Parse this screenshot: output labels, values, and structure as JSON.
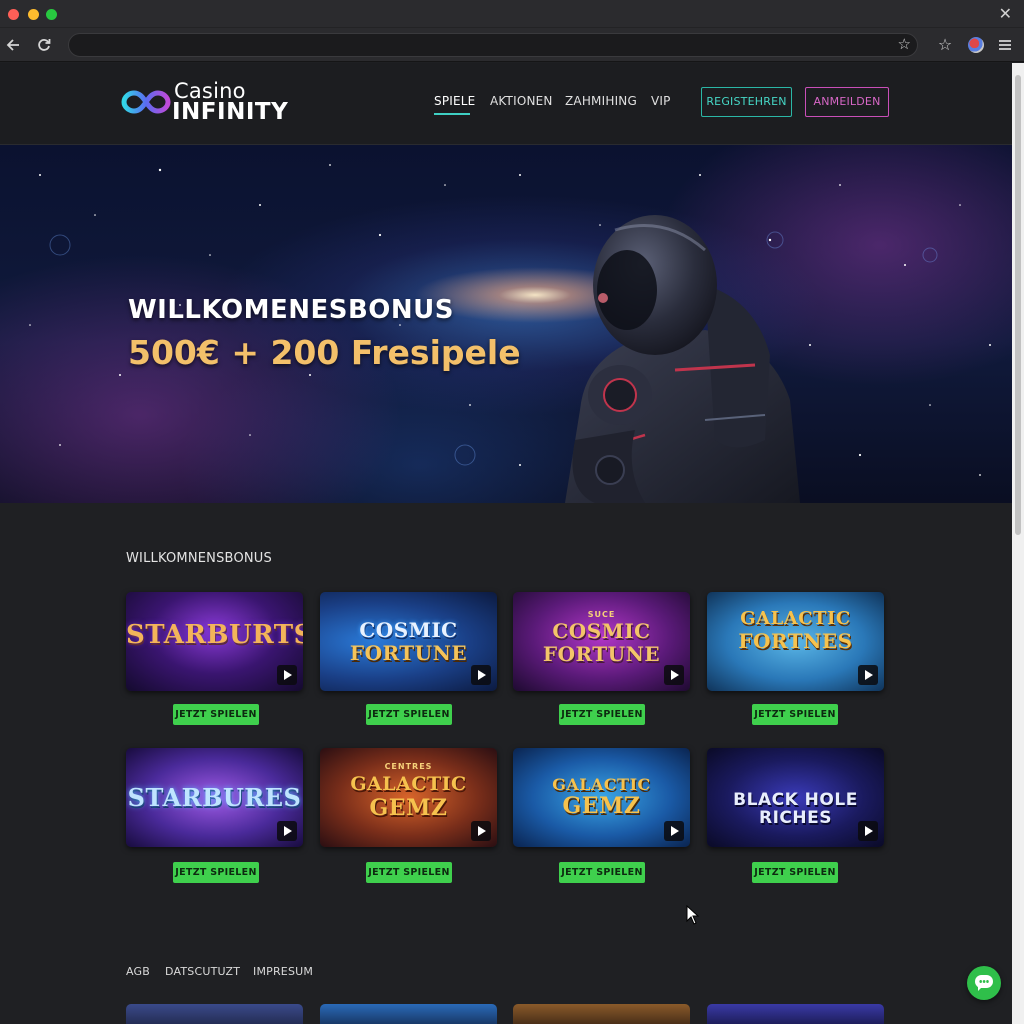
{
  "browser": {
    "close_glyph": "✕",
    "back_icon": "arrow-left-icon",
    "reload_icon": "reload-icon",
    "bookmark_icon": "star-icon",
    "menu_icon": "hamburger-menu-icon",
    "address_value": ""
  },
  "header": {
    "logo_top": "Casino",
    "logo_bottom": "INFINITY",
    "nav": [
      "SPIELE",
      "AKTIONEN",
      "ZAHMIHING",
      "VIP"
    ],
    "active_nav": "SPIELE",
    "register_label": "REGISTEHREN",
    "login_label": "ANMEILDEN"
  },
  "hero": {
    "title": "WILLKOMENESBONUS",
    "subtitle": "500€ + 200 Fresipele"
  },
  "games": {
    "section_title": "WILLKOMNENSBONUS",
    "play_label": "JETZT SPIELEN",
    "items": [
      {
        "title_lines": [
          "STARBURTS"
        ],
        "kicker": ""
      },
      {
        "title_lines": [
          "COSMIC",
          "FORTUNE"
        ],
        "kicker": ""
      },
      {
        "title_lines": [
          "COSMIC",
          "FORTUNE"
        ],
        "kicker": "SUCE"
      },
      {
        "title_lines": [
          "GALACTIC",
          "FORTNES"
        ],
        "kicker": ""
      },
      {
        "title_lines": [
          "STARBURES"
        ],
        "kicker": ""
      },
      {
        "title_lines": [
          "GALACTIC",
          "GEMZ"
        ],
        "kicker": "CENTRES"
      },
      {
        "title_lines": [
          "GALACTIC",
          "GEMZ"
        ],
        "kicker": ""
      },
      {
        "title_lines": [
          "BLACK HOLE",
          "RICHES"
        ],
        "kicker": ""
      }
    ]
  },
  "footer": {
    "links": [
      "AGB",
      "DATSCUTUZT",
      "IMPRESUM"
    ]
  },
  "colors": {
    "accent_teal": "#2bb7a6",
    "accent_pink": "#c94fb8",
    "play_green": "#3fd04d",
    "hero_gold": "#f3c06a"
  }
}
